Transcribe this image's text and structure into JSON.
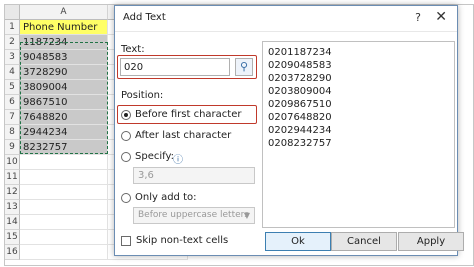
{
  "sheet": {
    "column_a": "A",
    "column_b": "B",
    "header_row_number": "1",
    "header_cell": "Phone Number",
    "rows": [
      {
        "num": "2",
        "value": "1187234"
      },
      {
        "num": "3",
        "value": "9048583"
      },
      {
        "num": "4",
        "value": "3728290"
      },
      {
        "num": "5",
        "value": "3809004"
      },
      {
        "num": "6",
        "value": "9867510"
      },
      {
        "num": "7",
        "value": "7648820"
      },
      {
        "num": "8",
        "value": "2944234"
      },
      {
        "num": "9",
        "value": "8232757"
      }
    ],
    "extra_rows": [
      "10",
      "11",
      "12",
      "13",
      "14",
      "15",
      "16"
    ]
  },
  "dialog": {
    "title": "Add Text",
    "help_label": "?",
    "close_label": "✕",
    "text_label": "Text:",
    "text_value": "020",
    "picker_icon": "⚲",
    "position_label": "Position:",
    "options": {
      "before": "Before first character",
      "after": "After last character",
      "specify": "Specify:",
      "only_add": "Only add to:"
    },
    "info_icon": "ⓘ",
    "specify_value": "3,6",
    "only_add_value": "Before uppercase letters",
    "preview": [
      "0201187234",
      "0209048583",
      "0203728290",
      "0203809004",
      "0209867510",
      "0207648820",
      "0202944234",
      "0208232757"
    ],
    "skip_label": "Skip non-text cells",
    "ok": "Ok",
    "cancel": "Cancel",
    "apply": "Apply"
  }
}
